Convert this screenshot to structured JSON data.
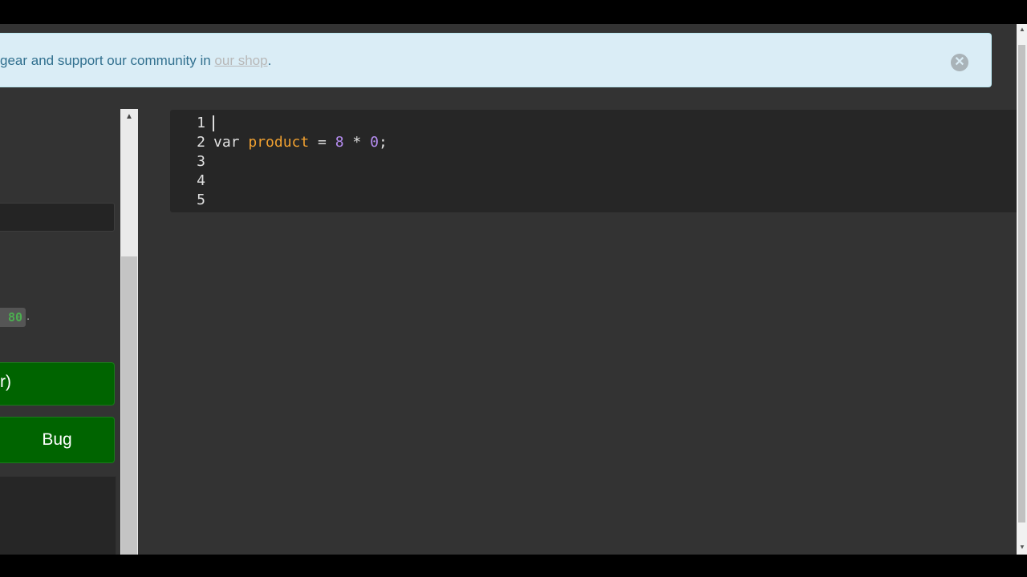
{
  "banner": {
    "text_prefix": "gear and support our community in ",
    "link_text": "our shop",
    "text_suffix": ".",
    "close_symbol": "✕"
  },
  "left_panel": {
    "code_value": "80",
    "code_period": ".",
    "run_button_label": "r)",
    "bug_button_label": "Bug"
  },
  "editor": {
    "lines": [
      {
        "number": "1",
        "tokens": []
      },
      {
        "number": "2",
        "tokens": [
          {
            "text": "var",
            "kind": "kw"
          },
          {
            "text": " ",
            "kind": "op"
          },
          {
            "text": "product",
            "kind": "ident"
          },
          {
            "text": " = ",
            "kind": "op"
          },
          {
            "text": "8",
            "kind": "num"
          },
          {
            "text": " * ",
            "kind": "op"
          },
          {
            "text": "0",
            "kind": "num"
          },
          {
            "text": ";",
            "kind": "punct"
          }
        ]
      },
      {
        "number": "3",
        "tokens": []
      },
      {
        "number": "4",
        "tokens": []
      },
      {
        "number": "5",
        "tokens": []
      }
    ]
  },
  "scrollbar": {
    "up_arrow": "▲",
    "down_arrow": "▼"
  }
}
